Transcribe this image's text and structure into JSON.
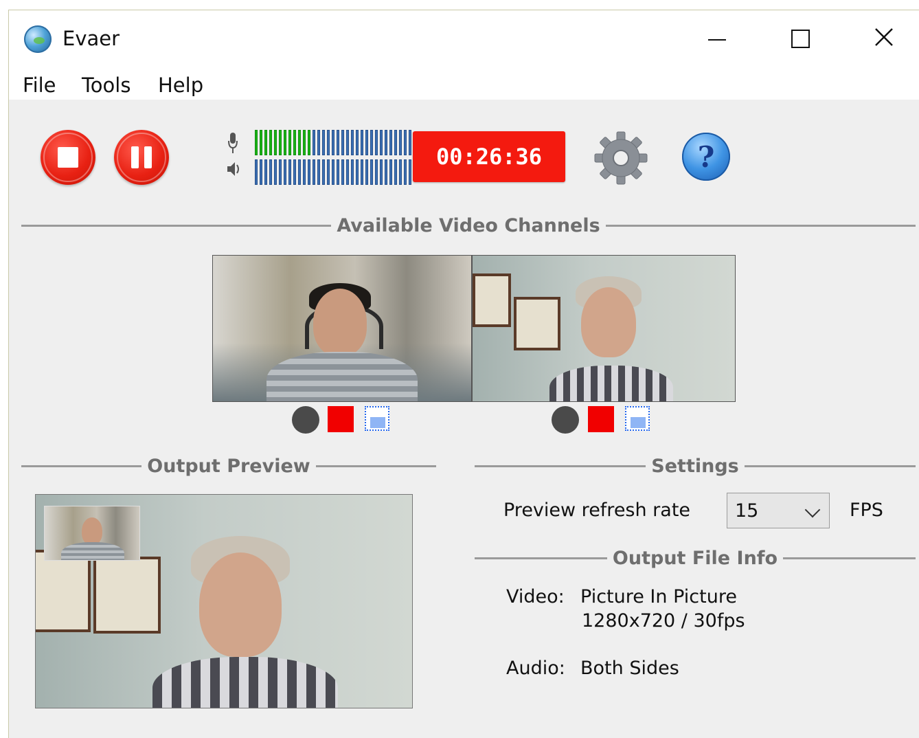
{
  "window": {
    "title": "Evaer"
  },
  "menu": {
    "items": [
      "File",
      "Tools",
      "Help"
    ]
  },
  "toolbar": {
    "timer": "00:26:36",
    "mic_level_segments_on": 12,
    "speaker_level_segments_on": 0,
    "meter_segments_total": 33
  },
  "sections": {
    "channels": "Available Video Channels",
    "output_preview": "Output Preview",
    "settings": "Settings",
    "output_file_info": "Output File Info"
  },
  "settings": {
    "refresh_label": "Preview refresh rate",
    "refresh_value": "15",
    "refresh_unit": "FPS"
  },
  "file_info": {
    "video_label": "Video:",
    "video_value": "Picture In Picture",
    "video_detail": "1280x720 / 30fps",
    "audio_label": "Audio:",
    "audio_value": "Both Sides"
  },
  "colors": {
    "record_red": "#f41a0f",
    "meter_green": "#18b414",
    "meter_blue": "#3b6fb3"
  }
}
